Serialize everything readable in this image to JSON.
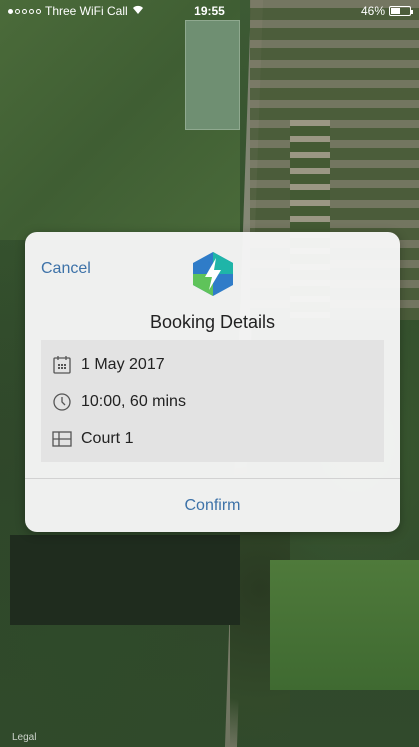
{
  "status_bar": {
    "carrier": "Three WiFi Call",
    "time": "19:55",
    "battery": "46%",
    "signal_icon": "signal-dots-icon",
    "wifi_icon": "wifi-icon",
    "battery_icon": "battery-icon"
  },
  "modal": {
    "cancel_label": "Cancel",
    "title": "Booking Details",
    "logo_icon": "lightning-hexagon-logo",
    "details": [
      {
        "icon": "calendar-icon",
        "text": "1 May 2017"
      },
      {
        "icon": "clock-icon",
        "text": "10:00, 60 mins"
      },
      {
        "icon": "court-grid-icon",
        "text": "Court 1"
      }
    ],
    "confirm_label": "Confirm"
  },
  "map": {
    "legal_label": "Legal"
  },
  "colors": {
    "accent": "#3d72a8",
    "logo_teal": "#1fb5a8",
    "logo_blue": "#2f7cc8",
    "logo_green": "#5fc35a",
    "details_bg": "#e3e3e3",
    "modal_bg": "#f6f6f6"
  }
}
